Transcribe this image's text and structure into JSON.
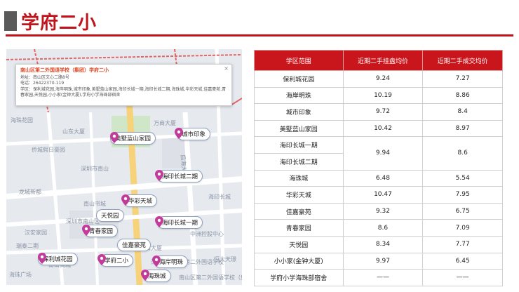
{
  "title": "学府二小",
  "map": {
    "popup": {
      "title": "南山区第二外国语学校（集团）学府二小",
      "address": "地址：南山区文心二路8号",
      "phone": "电话：26422370-119",
      "district": "学区：保利城花园,海岸明珠,城市印象,美墅蓝山家园,海印长城一期,海印长城二期,海珠城,华彩天城,佳嘉豪苑,青春家园,天悦园,小小家(金钟大厦)",
      "district_cont": ",学府小学海珠部宿舍",
      "close": "×"
    },
    "place_labels": [
      "海珠花园",
      "山东大厦",
      "万商大厦",
      "侨城假日豪园",
      "深圳市南山",
      "龙城新都",
      "南山书城",
      "深圳市南山区",
      "汉安家园",
      "瑞泰二期",
      "海印长城",
      "中洲控股中心",
      "南山大厦",
      "恒大天璟",
      "深圳市南山区第二外国语学校",
      "海珠广场",
      "南山区第二外国语学校（集团）",
      "后海大道",
      "南山商城"
    ],
    "pins": [
      {
        "name": "美墅蓝山家园"
      },
      {
        "name": "城市印象"
      },
      {
        "name": "海印长城二期"
      },
      {
        "name": "华彩天城"
      },
      {
        "name": "天悦园"
      },
      {
        "name": "海印长城一期"
      },
      {
        "name": "青春家园"
      },
      {
        "name": "佳嘉豪苑"
      },
      {
        "name": "保利城花园"
      },
      {
        "name": "学府二小"
      },
      {
        "name": "海岸明珠"
      },
      {
        "name": "海珠城"
      }
    ]
  },
  "table": {
    "headers": [
      "学区范围",
      "近期二手挂盘均价",
      "近期二手成交均价"
    ],
    "rows": [
      {
        "name": "保利城花园",
        "list": "9.24",
        "deal": "7.27"
      },
      {
        "name": "海岸明珠",
        "list": "10.19",
        "deal": "8.86"
      },
      {
        "name": "城市印象",
        "list": "9.72",
        "deal": "8.4"
      },
      {
        "name": "美墅蓝山家园",
        "list": "10.42",
        "deal": "8.97"
      },
      {
        "name": "海印长城一期",
        "list": "9.94",
        "deal": "8.6"
      },
      {
        "name": "海印长城二期"
      },
      {
        "name": "海珠城",
        "list": "6.48",
        "deal": "5.54"
      },
      {
        "name": "华彩天城",
        "list": "10.47",
        "deal": "7.95"
      },
      {
        "name": "佳嘉豪苑",
        "list": "9.32",
        "deal": "6.75"
      },
      {
        "name": "青春家园",
        "list": "8.6",
        "deal": "7.09"
      },
      {
        "name": "天悦园",
        "list": "8.34",
        "deal": "7.77"
      },
      {
        "name": "小小家(金钟大厦)",
        "list": "9.97",
        "deal": "6.45"
      },
      {
        "name": "学府小学海珠部宿舍",
        "list": "——",
        "deal": "——"
      }
    ]
  },
  "colors": {
    "accent": "#c0141c",
    "header_bg": "#c9161c",
    "pin": "#c23a9a"
  }
}
